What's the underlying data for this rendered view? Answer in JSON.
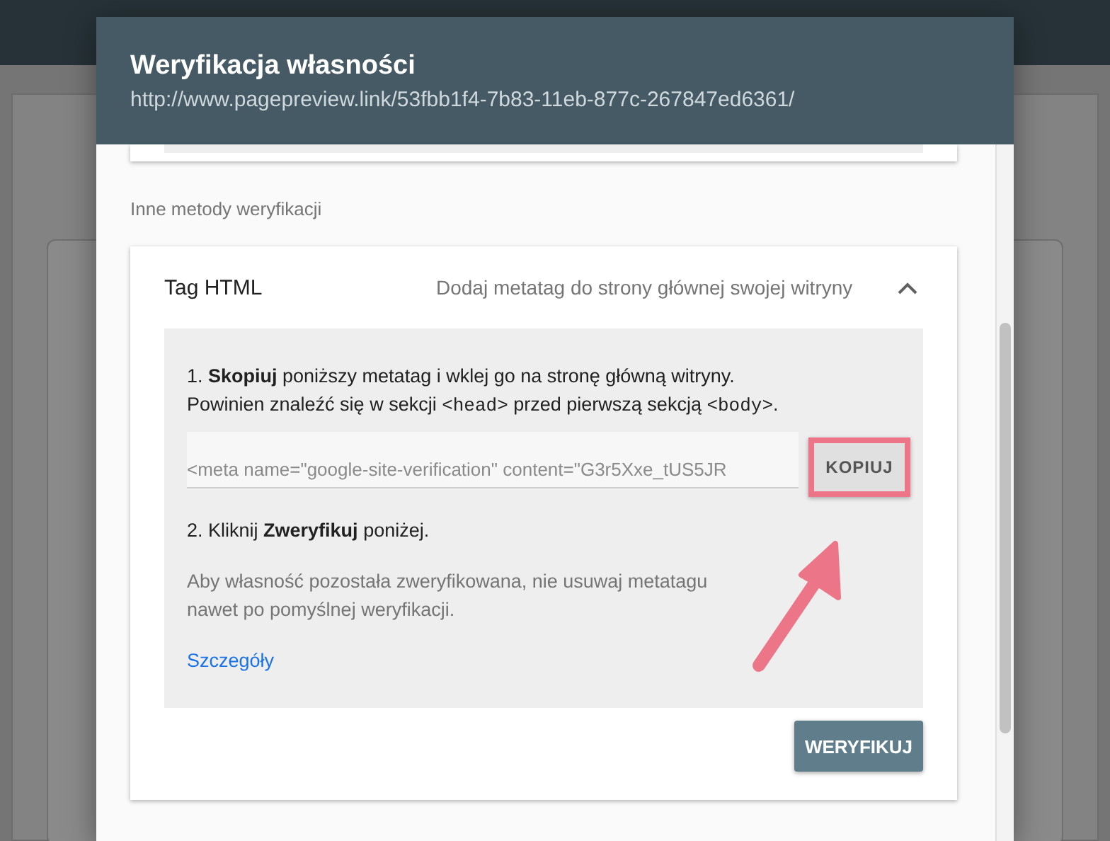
{
  "dialog": {
    "title": "Weryfikacja własności",
    "url": "http://www.pagepreview.link/53fbb1f4-7b83-11eb-877c-267847ed6361/"
  },
  "section_label": "Inne metody weryfikacji",
  "method": {
    "name": "Tag HTML",
    "description": "Dodaj metatag do strony głównej swojej witryny",
    "expanded": true,
    "step_1": [
      {
        "kind": "text",
        "text": "1. **Skopiuj** poniższy metatag i wklej go na stronę główną witryny. Powinien znaleźć się w sekcji "
      },
      {
        "kind": "code",
        "text": "<head>"
      },
      {
        "kind": "text",
        "text": " przed pierwszą sekcją "
      },
      {
        "kind": "code",
        "text": "<body>"
      },
      {
        "kind": "text",
        "text": "."
      }
    ],
    "meta_tag": "<meta name=\"google-site-verification\" content=\"G3r5Xxe_tUS5JR",
    "copy_button": {
      "label": "KOPIUJ",
      "highlighted": true
    },
    "step_2": "2. Kliknij **Zweryfikuj** poniżej.",
    "note": "Aby własność pozostała zweryfikowana, nie usuwaj metatagu nawet po pomyślnej weryfikacji.",
    "link": "Szczegóły",
    "verify_button": "WERYFIKUJ"
  }
}
